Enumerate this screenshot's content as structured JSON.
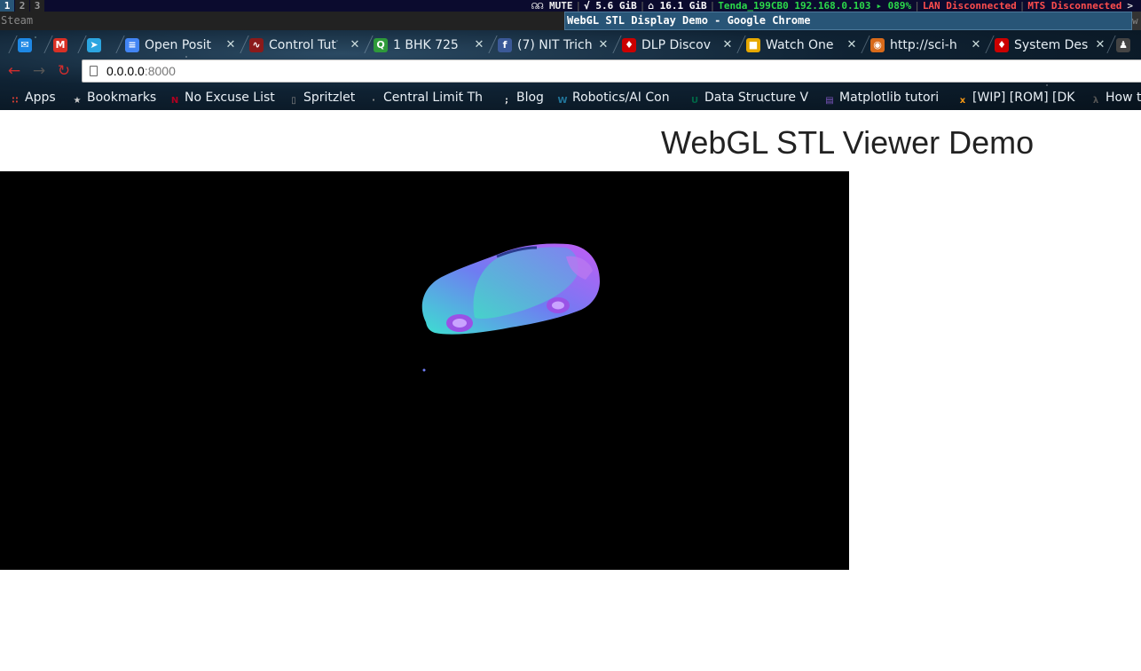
{
  "i3bar": {
    "workspaces": [
      "1",
      "2",
      "3"
    ],
    "status": {
      "mute": "☊☊ MUTE",
      "disk_root": "√ 5.6 GiB",
      "disk_home": "⌂ 16.1 GiB",
      "wifi": "Tenda_199CB0 192.168.0.103",
      "battery": "▸ 089%",
      "lan": "LAN Disconnected",
      "mts": "MTS Disconnected",
      "arrow": ">"
    }
  },
  "windows": {
    "steam_title": "Steam",
    "chrome_title": "WebGL STL Display Demo - Google Chrome",
    "right_fragment": "w"
  },
  "tabs": [
    {
      "title": "",
      "icon": "messenger-icon",
      "color": "#1e88e5",
      "glyph": "✉"
    },
    {
      "title": "",
      "icon": "gmail-icon",
      "color": "#d93025",
      "glyph": "M"
    },
    {
      "title": "",
      "icon": "telegram-icon",
      "color": "#2ca5e0",
      "glyph": "➤"
    },
    {
      "title": "Open Posit",
      "icon": "google-docs-icon",
      "color": "#4285f4",
      "glyph": "≡"
    },
    {
      "title": "Control Tut",
      "icon": "control-tutorial-icon",
      "color": "#8b1a1a",
      "glyph": "∿"
    },
    {
      "title": "1 BHK 725",
      "icon": "quikr-icon",
      "color": "#2e9a3a",
      "glyph": "Q"
    },
    {
      "title": "(7) NIT Trich",
      "icon": "facebook-icon",
      "color": "#3b5998",
      "glyph": "f"
    },
    {
      "title": "DLP Discov",
      "icon": "ti-icon",
      "color": "#cc0000",
      "glyph": "♦"
    },
    {
      "title": "Watch One",
      "icon": "video-site-icon",
      "color": "#e6a800",
      "glyph": "■"
    },
    {
      "title": "http://sci-h",
      "icon": "scihub-icon",
      "color": "#d86a1a",
      "glyph": "◉"
    },
    {
      "title": "System Des",
      "icon": "ti-icon",
      "color": "#cc0000",
      "glyph": "♦"
    },
    {
      "title": "",
      "icon": "person-icon",
      "color": "#444444",
      "glyph": "♟"
    }
  ],
  "toolbar": {
    "back": "←",
    "forward": "→",
    "reload": "↻",
    "url_host": "0.0.0.0",
    "url_port": ":8000"
  },
  "bookmarks": [
    {
      "label": "Apps",
      "icon": "apps-grid-icon",
      "color": "#e94235",
      "glyph": "∷"
    },
    {
      "label": "Bookmarks",
      "icon": "star-icon",
      "color": "#cccccc",
      "glyph": "★"
    },
    {
      "label": "No Excuse List",
      "icon": "no-excuse-icon",
      "color": "#b00020",
      "glyph": "N"
    },
    {
      "label": "Spritzlet",
      "icon": "page-icon",
      "color": "#888888",
      "glyph": "▯"
    },
    {
      "label": "Central Limit Th",
      "icon": "dots-icon",
      "color": "#999999",
      "glyph": "·"
    },
    {
      "label": "Blog",
      "icon": "semicolon-icon",
      "color": "#dddddd",
      "glyph": ";"
    },
    {
      "label": "Robotics/AI Con",
      "icon": "wordpress-icon",
      "color": "#21759b",
      "glyph": "W"
    },
    {
      "label": "Data Structure V",
      "icon": "usf-icon",
      "color": "#006747",
      "glyph": "U"
    },
    {
      "label": "Matplotlib tutori",
      "icon": "notebook-icon",
      "color": "#7e57c2",
      "glyph": "▤"
    },
    {
      "label": "[WIP] [ROM] [DK",
      "icon": "xda-icon",
      "color": "#f59714",
      "glyph": "x"
    },
    {
      "label": "How t",
      "icon": "lambda-icon",
      "color": "#555555",
      "glyph": "λ"
    }
  ],
  "page": {
    "heading": "WebGL STL Viewer Demo"
  },
  "colors": {
    "i3_background": "#0b0b2e",
    "focused_title": "#285577",
    "canvas_background": "#000000",
    "status_green": "#2bd94a",
    "status_red": "#ff4d4d",
    "model_gradient": [
      "#3ce0d0",
      "#6f7cf2",
      "#c35cf5"
    ]
  }
}
